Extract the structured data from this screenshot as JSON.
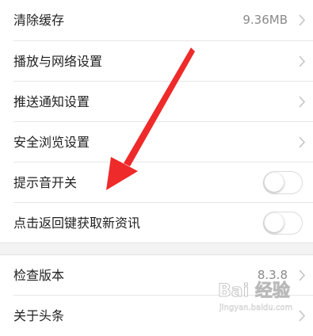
{
  "settings": {
    "items": [
      {
        "label": "清除缓存",
        "value": "9.36MB"
      },
      {
        "label": "播放与网络设置"
      },
      {
        "label": "推送通知设置"
      },
      {
        "label": "安全浏览设置"
      },
      {
        "label": "提示音开关",
        "toggle_on": false
      },
      {
        "label": "点击返回键获取新资讯",
        "toggle_on": false
      },
      {
        "label": "检查版本",
        "value": "8.3.8"
      },
      {
        "label": "关于头条"
      }
    ]
  },
  "colors": {
    "annotation_arrow": "#ee2a2a",
    "chevron": "#c4c4c4",
    "text": "#222222",
    "secondary_text": "#8a8a8a"
  },
  "icons": {
    "chevron": "chevron-right-icon",
    "annotation": "red-arrow-icon",
    "watermark": "baidu-jingyan-watermark"
  },
  "watermark": {
    "text": "Bai 经验",
    "subtext": "jingyan.baidu.com"
  }
}
